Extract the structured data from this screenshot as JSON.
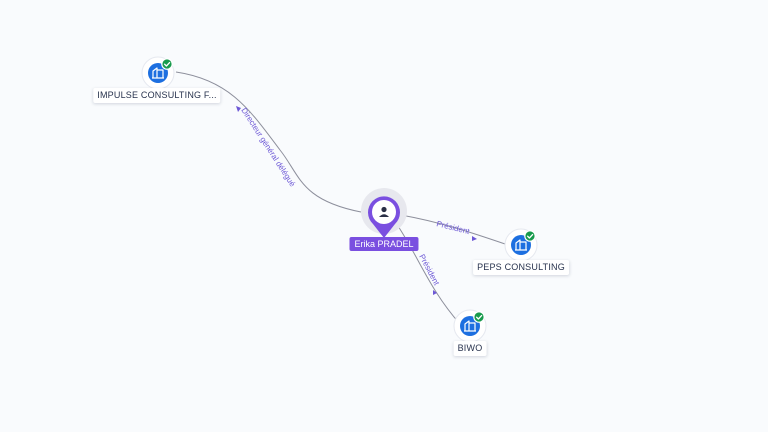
{
  "colors": {
    "person_accent": "#7a4fe0",
    "company_accent": "#1d6fe0",
    "verified_badge": "#179a4c",
    "edge_label": "#6d58d6",
    "edge_line": "#8d8f9c"
  },
  "person": {
    "name": "Erika PRADEL",
    "icon": "person-icon"
  },
  "companies": [
    {
      "name": "IMPULSE CONSULTING F...",
      "icon": "building-icon",
      "verified": true
    },
    {
      "name": "PEPS CONSULTING",
      "icon": "building-icon",
      "verified": true
    },
    {
      "name": "BIWO",
      "icon": "building-icon",
      "verified": true
    }
  ],
  "relations": [
    {
      "label": "Directeur général délégué",
      "to": "IMPULSE CONSULTING F..."
    },
    {
      "label": "Président",
      "to": "PEPS CONSULTING"
    },
    {
      "label": "Président",
      "to": "BIWO"
    }
  ]
}
